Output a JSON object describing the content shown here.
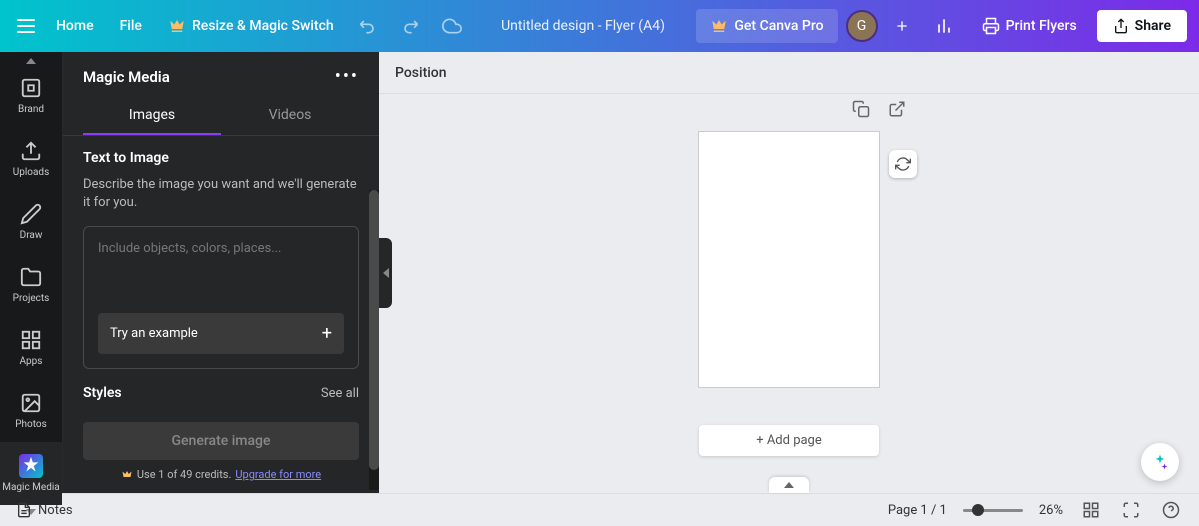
{
  "header": {
    "home": "Home",
    "file": "File",
    "resize": "Resize & Magic Switch",
    "design_title": "Untitled design - Flyer (A4)",
    "get_pro": "Get Canva Pro",
    "avatar_initial": "G",
    "print": "Print Flyers",
    "share": "Share"
  },
  "sidebar": {
    "items": [
      {
        "label": "Brand"
      },
      {
        "label": "Uploads"
      },
      {
        "label": "Draw"
      },
      {
        "label": "Projects"
      },
      {
        "label": "Apps"
      },
      {
        "label": "Photos"
      },
      {
        "label": "Magic Media"
      }
    ]
  },
  "panel": {
    "title": "Magic Media",
    "tabs": {
      "images": "Images",
      "videos": "Videos"
    },
    "text_to_image": "Text to Image",
    "description": "Describe the image you want and we'll generate it for you.",
    "placeholder": "Include objects, colors, places...",
    "try_example": "Try an example",
    "styles": "Styles",
    "see_all": "See all",
    "generate": "Generate image",
    "credits": "Use 1 of 49 credits.",
    "upgrade": "Upgrade for more"
  },
  "canvas": {
    "position": "Position",
    "add_page": "+ Add page"
  },
  "bottom": {
    "notes": "Notes",
    "page_counter": "Page 1 / 1",
    "zoom": "26%"
  }
}
